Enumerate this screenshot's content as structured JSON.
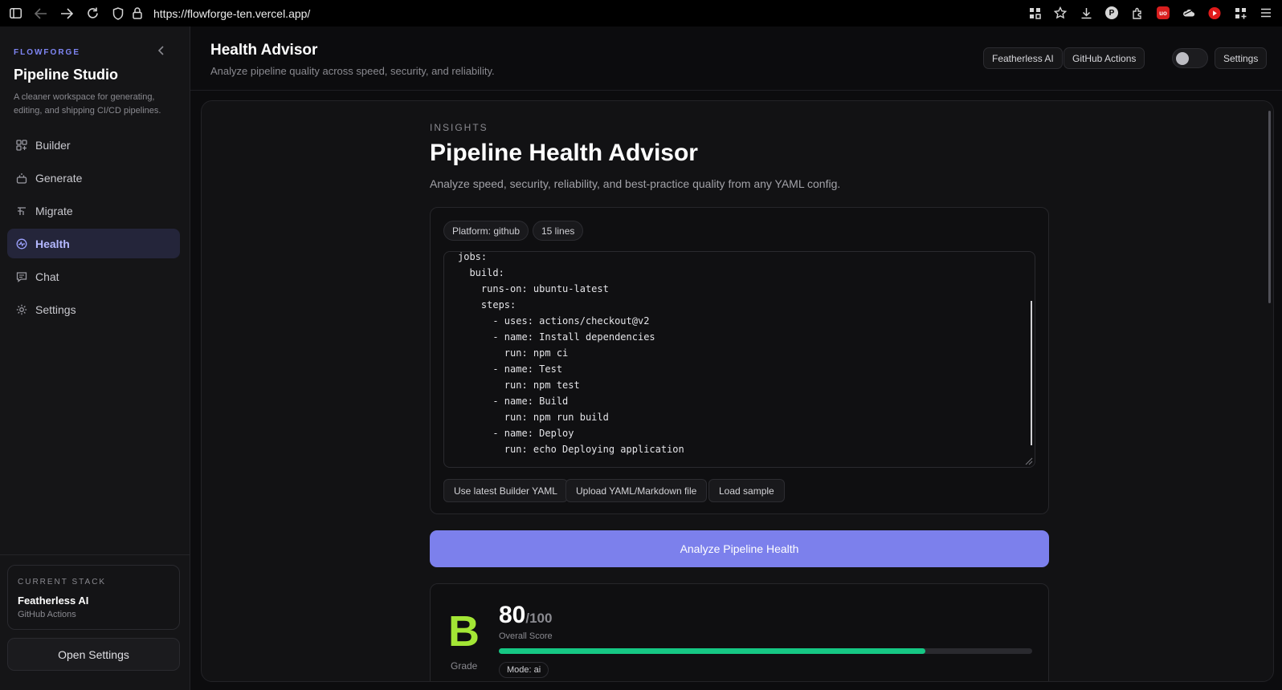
{
  "browser": {
    "url": "https://flowforge-ten.vercel.app/",
    "icons": [
      "sidebar-icon",
      "back-icon",
      "forward-icon",
      "reload-icon",
      "shield-icon",
      "lock-icon"
    ],
    "extensions": [
      "grid-icon",
      "star-icon",
      "download-icon",
      "p-extension-icon",
      "puzzle-icon",
      "ublock-icon",
      "cloud-icon",
      "youtube-icon",
      "apps-icon",
      "menu-icon"
    ],
    "ublock_text": "uo",
    "p_text": "P"
  },
  "sidebar": {
    "brand_tag": "FLOWFORGE",
    "title": "Pipeline Studio",
    "description": "A cleaner workspace for generating, editing, and shipping CI/CD pipelines.",
    "items": [
      {
        "label": "Builder",
        "icon": "builder-icon",
        "active": false
      },
      {
        "label": "Generate",
        "icon": "generate-icon",
        "active": false
      },
      {
        "label": "Migrate",
        "icon": "migrate-icon",
        "active": false
      },
      {
        "label": "Health",
        "icon": "health-icon",
        "active": true
      },
      {
        "label": "Chat",
        "icon": "chat-icon",
        "active": false
      },
      {
        "label": "Settings",
        "icon": "settings-icon",
        "active": false
      }
    ],
    "stack": {
      "label": "CURRENT STACK",
      "name": "Featherless AI",
      "platform": "GitHub Actions"
    },
    "open_settings": "Open Settings"
  },
  "header": {
    "title": "Health Advisor",
    "subtitle": "Analyze pipeline quality across speed, security, and reliability.",
    "chips": {
      "provider": "Featherless AI",
      "platform": "GitHub Actions",
      "settings": "Settings"
    }
  },
  "main": {
    "kicker": "INSIGHTS",
    "title": "Pipeline Health Advisor",
    "subtitle": "Analyze speed, security, reliability, and best-practice quality from any YAML config.",
    "pills": {
      "platform": "Platform: github",
      "lines": "15 lines"
    },
    "yaml": "jobs:\n  build:\n    runs-on: ubuntu-latest\n    steps:\n      - uses: actions/checkout@v2\n      - name: Install dependencies\n        run: npm ci\n      - name: Test\n        run: npm test\n      - name: Build\n        run: npm run build\n      - name: Deploy\n        run: echo Deploying application",
    "actions": {
      "use_latest": "Use latest Builder YAML",
      "upload": "Upload YAML/Markdown file",
      "load_sample": "Load sample"
    },
    "analyze_button": "Analyze Pipeline Health",
    "result": {
      "grade": "B",
      "grade_label": "Grade",
      "score": "80",
      "score_max": "/100",
      "score_value": 80,
      "score_label": "Overall Score",
      "mode": "Mode: ai"
    }
  },
  "colors": {
    "accent": "#7c80ec",
    "grade_green": "#a3e635",
    "progress": "#16c784"
  }
}
